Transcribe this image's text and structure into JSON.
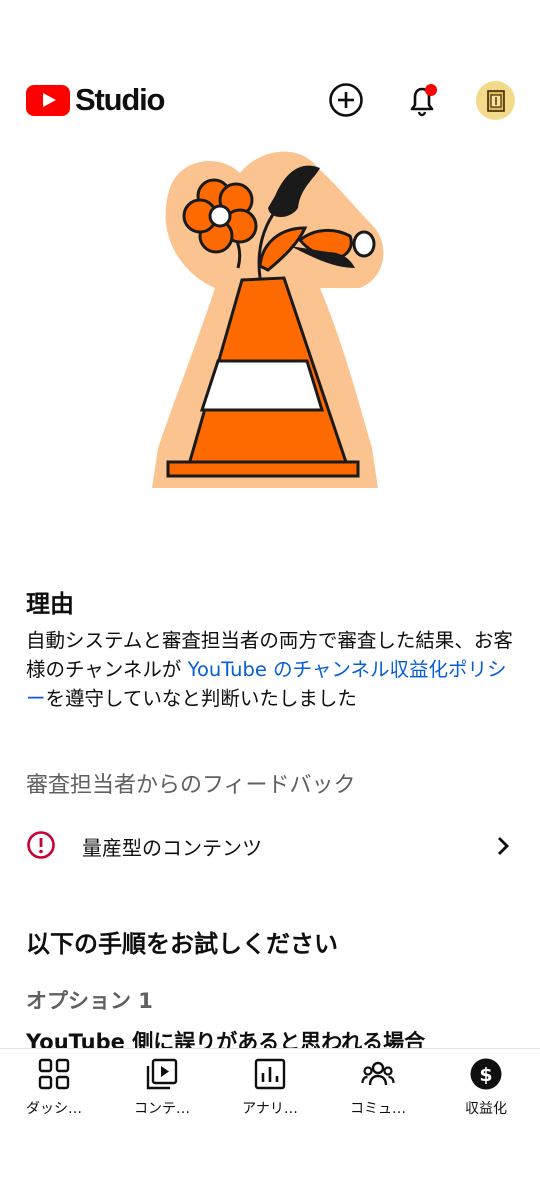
{
  "header": {
    "logo_text": "Studio",
    "notification_dot_color": "#ff0000",
    "brand_color": "#ff0000"
  },
  "reason": {
    "title": "理由",
    "text_before": "自動システムと審査担当者の両方で審査した結果、お客様のチャンネルが ",
    "link_text": "YouTube のチャンネル収益化ポリシー",
    "text_after": "を遵守していなと判断いたしました",
    "link_color": "#065fd4"
  },
  "feedback": {
    "heading": "審査担当者からのフィードバック",
    "item_label": "量産型のコンテンツ",
    "alert_color": "#cc0033"
  },
  "steps": {
    "title": "以下の手順をお試しください",
    "option_label": "オプション 1",
    "option_text": "YouTube 側に誤りがあると思われる場合"
  },
  "bottom_nav": [
    {
      "label": "ダッシ…",
      "icon": "dashboard-icon"
    },
    {
      "label": "コンテ…",
      "icon": "content-icon"
    },
    {
      "label": "アナリ…",
      "icon": "analytics-icon"
    },
    {
      "label": "コミュ…",
      "icon": "community-icon"
    },
    {
      "label": "収益化",
      "icon": "monetization-icon",
      "active": true
    }
  ]
}
